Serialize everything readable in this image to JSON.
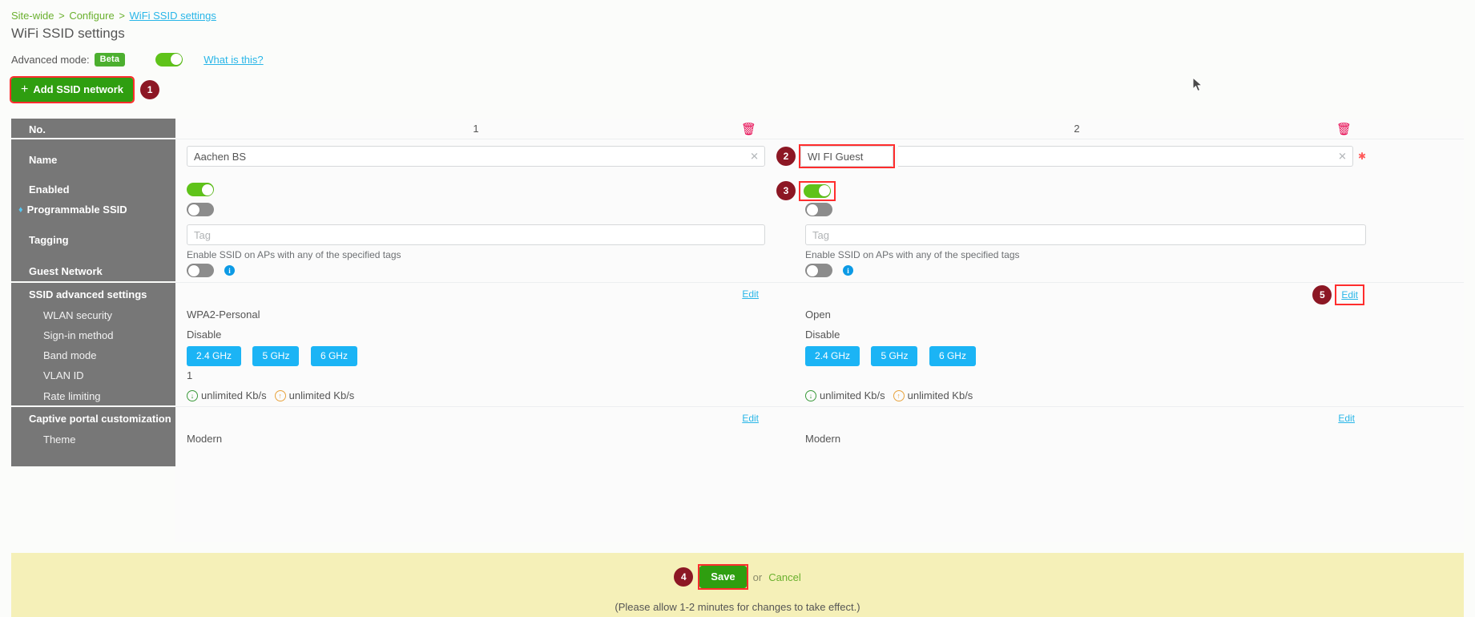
{
  "breadcrumb": {
    "items": [
      "Site-wide",
      "Configure"
    ],
    "current": "WiFi SSID settings",
    "separator": ">"
  },
  "page_title": "WiFi SSID settings",
  "advanced_mode": {
    "label": "Advanced mode:",
    "badge": "Beta",
    "toggle_state": "on",
    "help_link": "What is this?"
  },
  "add_button": {
    "label": "Add SSID network",
    "icon": "plus-icon",
    "badge": "1"
  },
  "sidebar": {
    "rows": [
      {
        "label": "No.",
        "bold": true
      },
      {
        "label": "Name",
        "bold": true
      },
      {
        "label": "Enabled",
        "bold": true
      },
      {
        "label": "Programmable SSID",
        "bold": true,
        "icon": "gem-icon"
      },
      {
        "label": "Tagging",
        "bold": true
      },
      {
        "label": "Guest Network",
        "bold": true
      },
      {
        "label": "SSID advanced settings",
        "bold": true
      },
      {
        "label": "WLAN security",
        "indent": true
      },
      {
        "label": "Sign-in method",
        "indent": true
      },
      {
        "label": "Band mode",
        "indent": true
      },
      {
        "label": "VLAN ID",
        "indent": true
      },
      {
        "label": "Rate limiting",
        "indent": true
      },
      {
        "label": "Captive portal customization",
        "bold": true
      },
      {
        "label": "Theme",
        "indent": true
      }
    ]
  },
  "columns": [
    {
      "number": "1",
      "delete_icon": "trash-icon",
      "name_value": "Aachen BS",
      "name_placeholder": "",
      "enabled": "on",
      "programmable_ssid": "off",
      "tag_value": "",
      "tag_placeholder": "Tag",
      "tag_helper": "Enable SSID on APs with any of the specified tags",
      "guest_network": "off",
      "advanced_edit": "Edit",
      "wlan_security": "WPA2-Personal",
      "signin_method": "Disable",
      "bands": [
        "2.4 GHz",
        "5 GHz",
        "6 GHz"
      ],
      "vlan_id": "1",
      "rate_down": "unlimited Kb/s",
      "rate_up": "unlimited Kb/s",
      "portal_edit": "Edit",
      "theme": "Modern"
    },
    {
      "number": "2",
      "delete_icon": "trash-icon",
      "name_value": "WI FI Guest",
      "name_placeholder": "",
      "enabled": "on",
      "programmable_ssid": "off",
      "tag_value": "",
      "tag_placeholder": "Tag",
      "tag_helper": "Enable SSID on APs with any of the specified tags",
      "guest_network": "off",
      "advanced_edit": "Edit",
      "wlan_security": "Open",
      "signin_method": "Disable",
      "bands": [
        "2.4 GHz",
        "5 GHz",
        "6 GHz"
      ],
      "vlan_id": "",
      "rate_down": "unlimited Kb/s",
      "rate_up": "unlimited Kb/s",
      "portal_edit": "Edit",
      "theme": "Modern"
    }
  ],
  "annotations": {
    "name_badge": "2",
    "enabled_badge": "3",
    "save_badge": "4",
    "edit_badge": "5"
  },
  "save_bar": {
    "save_label": "Save",
    "or_text": "or",
    "cancel_label": "Cancel",
    "note": "(Please allow 1-2 minutes for changes to take effect.)"
  },
  "colors": {
    "green": "#2f9e10",
    "accent_blue": "#29b6e8",
    "band_blue": "#1bb4f5",
    "badge_maroon": "#8c1724",
    "highlight_red": "#ff2d2d",
    "sidebar_gray": "#777777",
    "savebar_yellow": "#f5f0b8"
  }
}
